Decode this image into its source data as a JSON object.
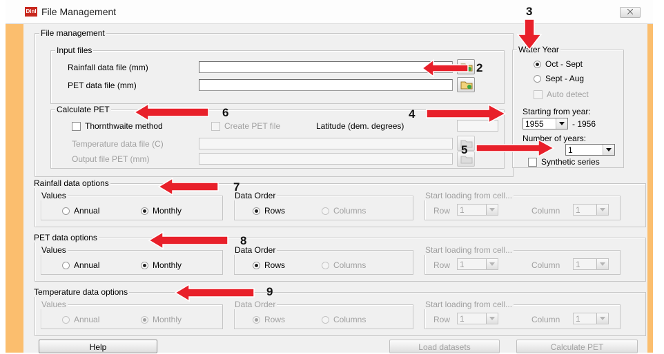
{
  "window": {
    "title": "File Management",
    "close_label": "⨉",
    "icon_label": "Dinl"
  },
  "file_management": {
    "label": "File management",
    "input_files": {
      "label": "Input files",
      "rainfall_label": "Rainfall data file (mm)",
      "rainfall_value": "",
      "pet_label": "PET data file (mm)",
      "pet_value": ""
    },
    "calculate_pet": {
      "label": "Calculate PET",
      "thornthwaite_label": "Thornthwaite method",
      "create_label": "Create PET file",
      "latitude_label": "Latitude (dem. degrees)",
      "temp_label": "Temperature data file (C)",
      "output_label": "Output file PET (mm)"
    }
  },
  "water_year": {
    "label": "Water Year",
    "options": [
      "Oct - Sept",
      "Sept - Aug"
    ],
    "selected": "Oct - Sept",
    "auto_detect_label": "Auto detect",
    "starting_label": "Starting from year:",
    "start_year": "1955",
    "dash_end_year": "- 1956",
    "num_years_label": "Number of years:",
    "num_years": "1",
    "synthetic_label": "Synthetic series"
  },
  "rainfall_options": {
    "label": "Rainfall data options",
    "values_label": "Values",
    "annual": "Annual",
    "monthly": "Monthly",
    "order_label": "Data Order",
    "rows": "Rows",
    "columns": "Columns",
    "start_label": "Start loading from cell...",
    "row_label": "Row",
    "row_value": "1",
    "column_label": "Column",
    "column_value": "1"
  },
  "pet_options": {
    "label": "PET data options",
    "values_label": "Values",
    "annual": "Annual",
    "monthly": "Monthly",
    "order_label": "Data Order",
    "rows": "Rows",
    "columns": "Columns",
    "start_label": "Start loading from cell...",
    "row_label": "Row",
    "row_value": "1",
    "column_label": "Column",
    "column_value": "1"
  },
  "temp_options": {
    "label": "Temperature data options",
    "values_label": "Values",
    "annual": "Annual",
    "monthly": "Monthly",
    "order_label": "Data Order",
    "rows": "Rows",
    "columns": "Columns",
    "start_label": "Start loading from cell...",
    "row_label": "Row",
    "row_value": "1",
    "column_label": "Column",
    "column_value": "1"
  },
  "buttons": {
    "help": "Help",
    "load": "Load datasets",
    "calculate": "Calculate PET"
  },
  "annotations": {
    "n2": "2",
    "n3": "3",
    "n4": "4",
    "n5": "5",
    "n6": "6",
    "n7": "7",
    "n8": "8",
    "n9": "9"
  },
  "colors": {
    "frame": "#fbbe6e",
    "arrow": "#e8202a",
    "dialog": "#f0f0f0"
  }
}
